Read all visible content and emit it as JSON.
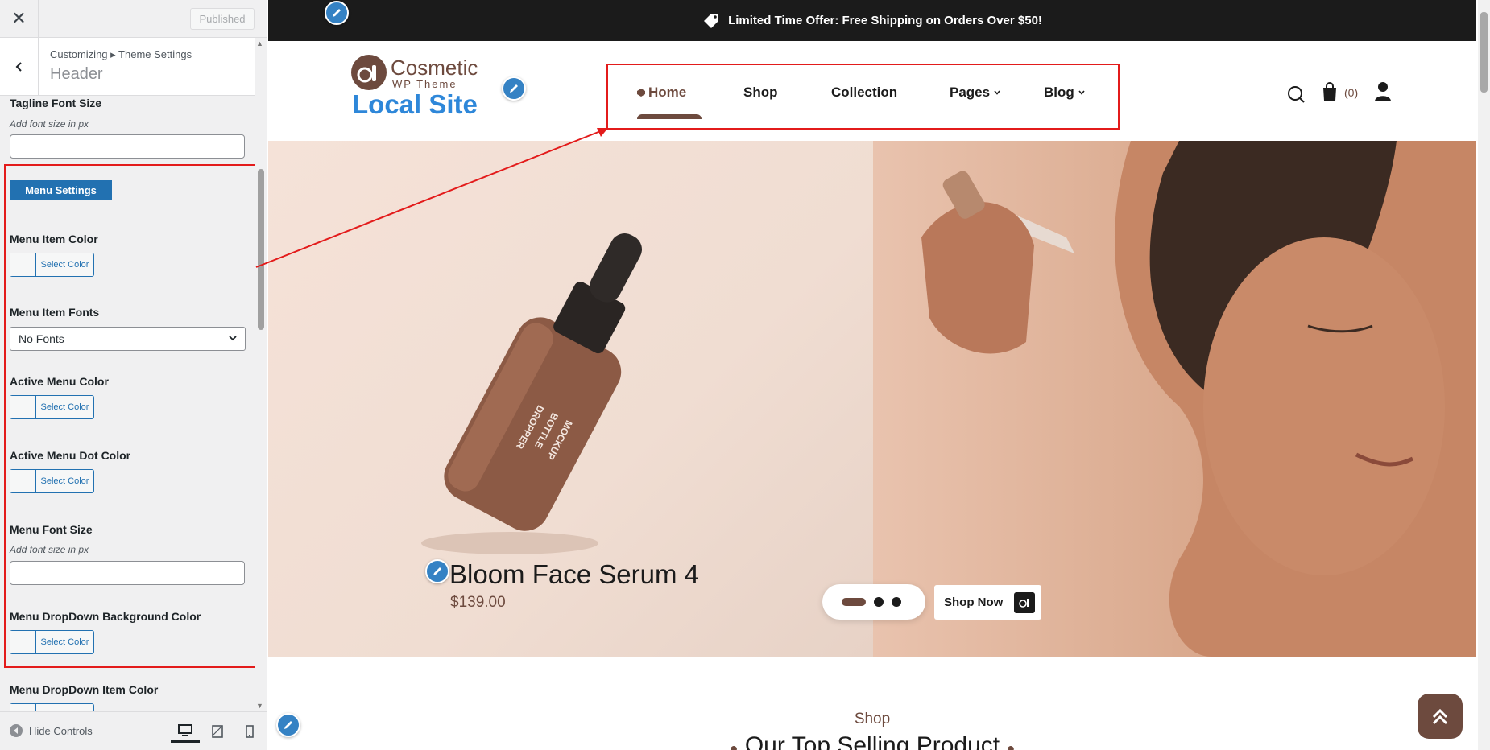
{
  "sidebar": {
    "close_icon": "close-icon",
    "publish_label": "Published",
    "breadcrumb": "Customizing ▸ Theme Settings",
    "section_title": "Header",
    "tagline_label": "Tagline Font Size",
    "tagline_desc": "Add font size in px",
    "tagline_value": "",
    "menu_settings_label": "Menu Settings",
    "menu_item_color_label": "Menu Item Color",
    "select_color": "Select Color",
    "menu_item_fonts_label": "Menu Item Fonts",
    "menu_item_fonts_value": "No Fonts",
    "active_menu_color_label": "Active Menu Color",
    "active_menu_dot_label": "Active Menu Dot Color",
    "menu_font_size_label": "Menu Font Size",
    "menu_font_size_desc": "Add font size in px",
    "menu_font_size_value": "",
    "dropdown_bg_label": "Menu DropDown Background Color",
    "dropdown_item_label": "Menu DropDown Item Color",
    "hide_controls": "Hide Controls",
    "device_icons": [
      "desktop-icon",
      "tablet-icon",
      "mobile-icon"
    ]
  },
  "preview": {
    "topbar_text": "Limited Time Offer: Free Shipping on Orders Over $50!",
    "logo_title": "Cosmetic",
    "logo_sub": "WP Theme",
    "site_title": "Local Site",
    "nav": [
      {
        "label": "Home",
        "active": true
      },
      {
        "label": "Shop"
      },
      {
        "label": "Collection"
      },
      {
        "label": "Pages",
        "dropdown": true
      },
      {
        "label": "Blog",
        "dropdown": true
      }
    ],
    "cart_count": "(0)",
    "slide_title": "Bloom Face Serum 4",
    "slide_price": "$139.00",
    "shop_now": "Shop Now",
    "section_eyebrow": "Shop",
    "section_heading": "Our Top Selling Product"
  },
  "colors": {
    "brand_brown": "#6d4a3e",
    "accent_blue": "#2271b1",
    "site_title_blue": "#2e87d9",
    "highlight_red": "#e31b1b",
    "topbar_bg": "#1b1b1b"
  }
}
